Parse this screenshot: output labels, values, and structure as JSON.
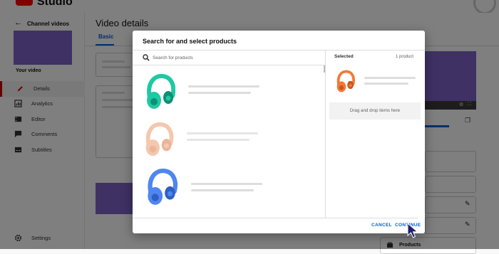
{
  "app": {
    "logo_text": "Studio"
  },
  "sidebar": {
    "channel_label": "Channel videos",
    "your_video_label": "Your video",
    "items": [
      {
        "label": "Details",
        "icon": "pencil-icon",
        "active": true
      },
      {
        "label": "Analytics",
        "icon": "analytics-icon",
        "active": false
      },
      {
        "label": "Editor",
        "icon": "editor-icon",
        "active": false
      },
      {
        "label": "Comments",
        "icon": "comments-icon",
        "active": false
      },
      {
        "label": "Subtitles",
        "icon": "subtitles-icon",
        "active": false
      }
    ],
    "settings_label": "Settings"
  },
  "main": {
    "title": "Video details",
    "tabs": [
      {
        "label": "Basic"
      }
    ],
    "right_panel": {
      "products_label": "Products"
    }
  },
  "dialog": {
    "title": "Search for and select products",
    "search": {
      "placeholder": "Search for products"
    },
    "products": [
      {
        "icon": "headphones-icon",
        "color": "#1ec9a3"
      },
      {
        "icon": "headphones-icon",
        "color": "#f4c8ae"
      },
      {
        "icon": "headphones-icon",
        "color": "#4f86f0"
      }
    ],
    "selected": {
      "heading": "Selected",
      "count": "1 product",
      "item": {
        "icon": "headphones-icon",
        "color": "#f07a36"
      },
      "drop_text": "Drag and drop items here"
    },
    "buttons": {
      "cancel": "CANCEL",
      "continue": "CONTINUE"
    }
  },
  "colors": {
    "accent": "#065fd4",
    "brand_red": "#ff0000",
    "thumbnail": "#7e62c6"
  }
}
